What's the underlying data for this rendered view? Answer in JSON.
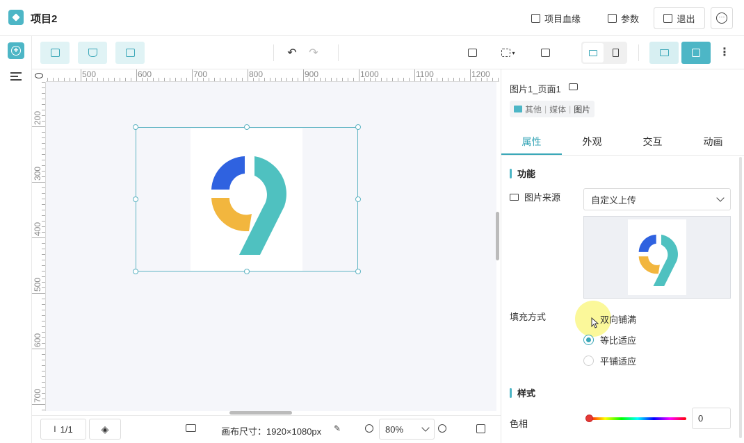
{
  "app": {
    "title": "项目2"
  },
  "header": {
    "lineage_label": "项目血缘",
    "params_label": "参数",
    "exit_label": "退出"
  },
  "toolbar": {
    "icons": [
      "add-page-icon",
      "filter-add-icon",
      "component-add-icon",
      "undo-icon",
      "redo-icon",
      "format-brush-icon",
      "align-icon",
      "layout-icon",
      "desktop-icon",
      "mobile-icon",
      "preview-icon",
      "save-icon",
      "more-icon"
    ]
  },
  "ruler": {
    "h_labels": [
      "500",
      "600",
      "700",
      "800",
      "900",
      "1000",
      "1100",
      "1200"
    ],
    "v_labels": [
      "200",
      "300",
      "400",
      "500",
      "600",
      "700"
    ]
  },
  "status": {
    "page_indicator": "1/1",
    "canvas_size_label": "画布尺寸：1920×1080px",
    "zoom": "80%"
  },
  "panel": {
    "component_name": "图片1_页面1",
    "crumb": {
      "a": "其他",
      "b": "媒体",
      "c": "图片"
    },
    "tabs": [
      "属性",
      "外观",
      "交互",
      "动画"
    ],
    "active_tab": "属性",
    "section_function": "功能",
    "source_label": "图片来源",
    "source_value": "自定义上传",
    "fill_label": "填充方式",
    "fill_options": [
      "双向铺满",
      "等比适应",
      "平铺适应"
    ],
    "fill_selected": "等比适应",
    "section_style": "样式",
    "hue_label": "色相",
    "hue_value": "0"
  },
  "colors": {
    "accent": "#4db6c6",
    "logo_blue": "#2f62e0",
    "logo_yellow": "#f2b63e",
    "logo_teal": "#4fc1c0"
  }
}
